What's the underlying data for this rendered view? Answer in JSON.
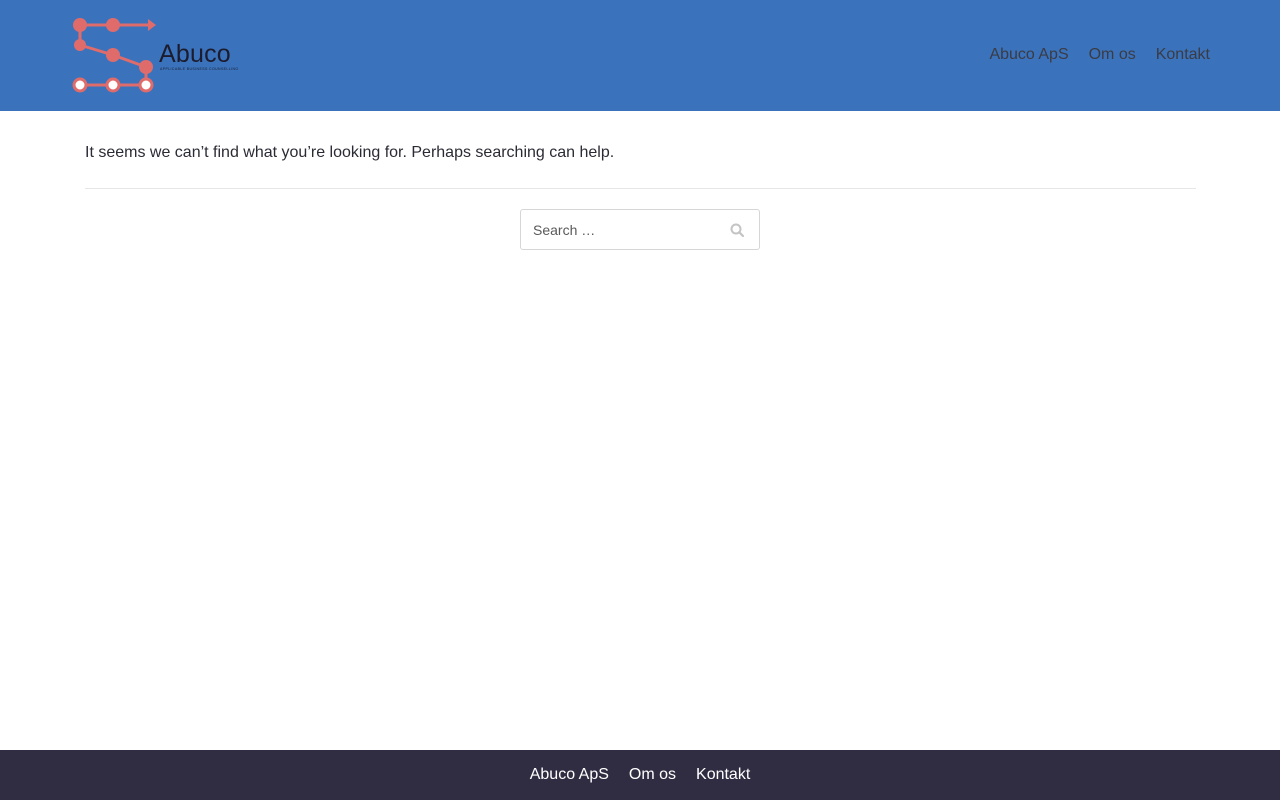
{
  "header": {
    "logo": {
      "name": "Abuco",
      "tagline": "APPLICABLE BUSINESS COUNSELLING",
      "color": "#e06b6b"
    },
    "nav": [
      {
        "label": "Abuco ApS"
      },
      {
        "label": "Om os"
      },
      {
        "label": "Kontakt"
      }
    ],
    "background": "#3a73bb"
  },
  "main": {
    "message": "It seems we can’t find what you’re looking for. Perhaps searching can help.",
    "search": {
      "placeholder": "Search …",
      "value": "",
      "button_icon": "search-icon"
    }
  },
  "footer": {
    "nav": [
      {
        "label": "Abuco ApS"
      },
      {
        "label": "Om os"
      },
      {
        "label": "Kontakt"
      }
    ],
    "background": "#302d43"
  }
}
